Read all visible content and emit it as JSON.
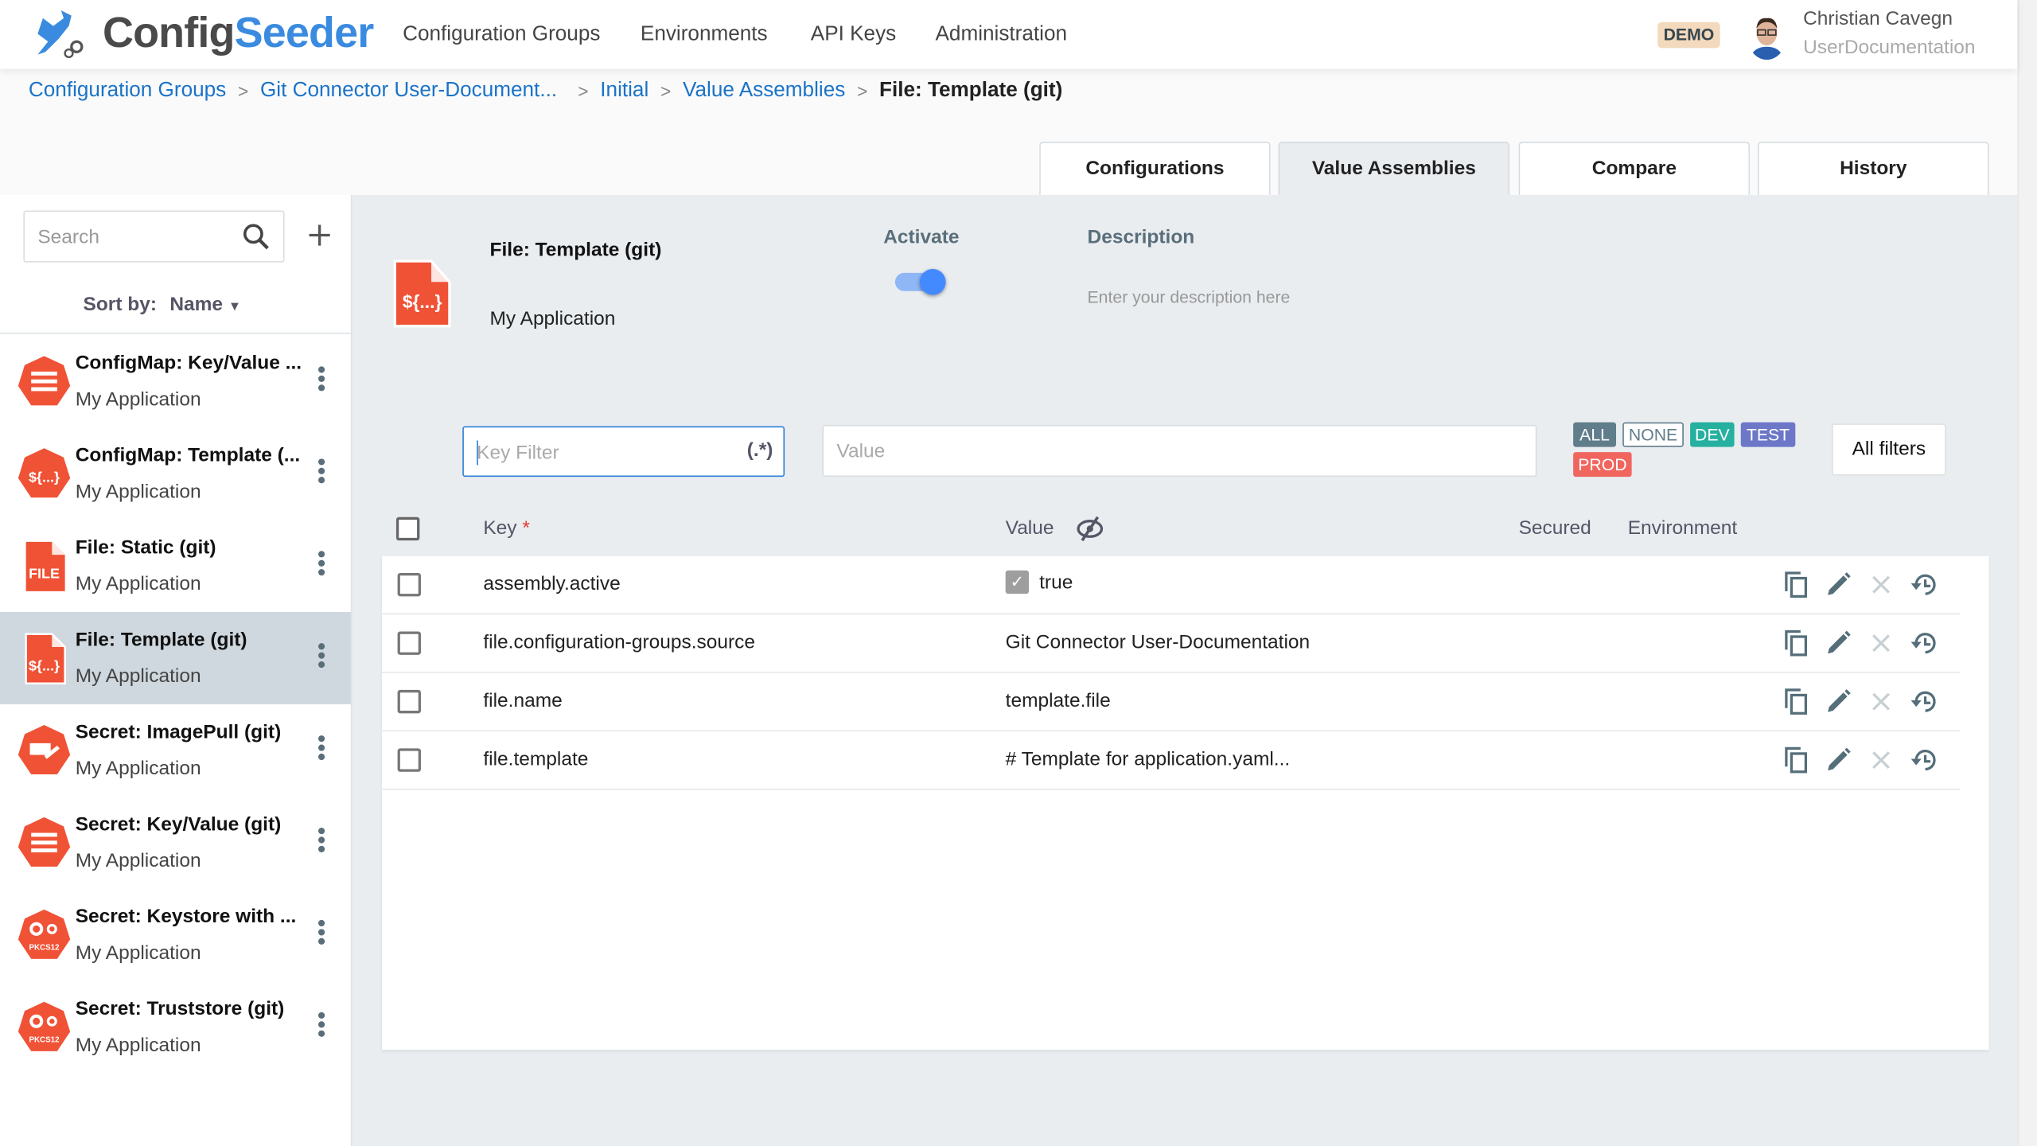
{
  "app": {
    "brand_part1": "Config",
    "brand_part2": "Seeder",
    "badge": "DEMO"
  },
  "nav": [
    "Configuration Groups",
    "Environments",
    "API Keys",
    "Administration"
  ],
  "user": {
    "name": "Christian Cavegn",
    "org": "UserDocumentation"
  },
  "breadcrumb": [
    "Configuration Groups",
    "Git Connector User-Document...",
    "Initial",
    "Value Assemblies",
    "File: Template (git)"
  ],
  "tabs": [
    {
      "label": "Configurations"
    },
    {
      "label": "Value Assemblies",
      "active": true
    },
    {
      "label": "Compare"
    },
    {
      "label": "History"
    }
  ],
  "sidebar": {
    "search_placeholder": "Search",
    "sort_label": "Sort by:",
    "sort_value": "Name",
    "items": [
      {
        "title": "ConfigMap: Key/Value ...",
        "subtitle": "My Application",
        "icon": "configmap-keyvalue-icon"
      },
      {
        "title": "ConfigMap: Template (...",
        "subtitle": "My Application",
        "icon": "configmap-template-icon"
      },
      {
        "title": "File: Static (git)",
        "subtitle": "My Application",
        "icon": "file-static-icon",
        "icon_text": "FILE"
      },
      {
        "title": "File: Template (git)",
        "subtitle": "My Application",
        "icon": "file-template-icon",
        "selected": true
      },
      {
        "title": "Secret: ImagePull (git)",
        "subtitle": "My Application",
        "icon": "secret-imagepull-icon"
      },
      {
        "title": "Secret: Key/Value (git)",
        "subtitle": "My Application",
        "icon": "secret-keyvalue-icon"
      },
      {
        "title": "Secret: Keystore with ...",
        "subtitle": "My Application",
        "icon": "secret-keystore-icon",
        "icon_text": "PKCS12"
      },
      {
        "title": "Secret: Truststore (git)",
        "subtitle": "My Application",
        "icon": "secret-truststore-icon",
        "icon_text": "PKCS12"
      }
    ]
  },
  "assembly": {
    "title": "File: Template (git)",
    "subtitle": "My Application",
    "icon_text": "${...}",
    "activate_label": "Activate",
    "active": true,
    "description_label": "Description",
    "description_placeholder": "Enter your description here"
  },
  "filters": {
    "key_placeholder": "Key Filter",
    "regex_label": "(.*)",
    "value_placeholder": "Value",
    "envs": [
      {
        "label": "ALL",
        "color": "#607d8b"
      },
      {
        "label": "NONE",
        "color": "outline"
      },
      {
        "label": "DEV",
        "color": "#26b0a0"
      },
      {
        "label": "TEST",
        "color": "#6c77c8"
      },
      {
        "label": "PROD",
        "color": "#f0665e"
      }
    ],
    "all_filters_label": "All filters"
  },
  "table": {
    "headers": {
      "key": "Key",
      "required": "*",
      "value": "Value",
      "secured": "Secured",
      "environment": "Environment"
    },
    "rows": [
      {
        "key": "assembly.active",
        "value": "true",
        "value_checkbox": true
      },
      {
        "key": "file.configuration-groups.source",
        "value": "Git Connector User-Documentation"
      },
      {
        "key": "file.name",
        "value": "template.file"
      },
      {
        "key": "file.template",
        "value": "# Template for application.yaml..."
      }
    ]
  },
  "colors": {
    "accent": "#1a73c8",
    "icon_red": "#f05236",
    "toggle": "#448aff"
  }
}
